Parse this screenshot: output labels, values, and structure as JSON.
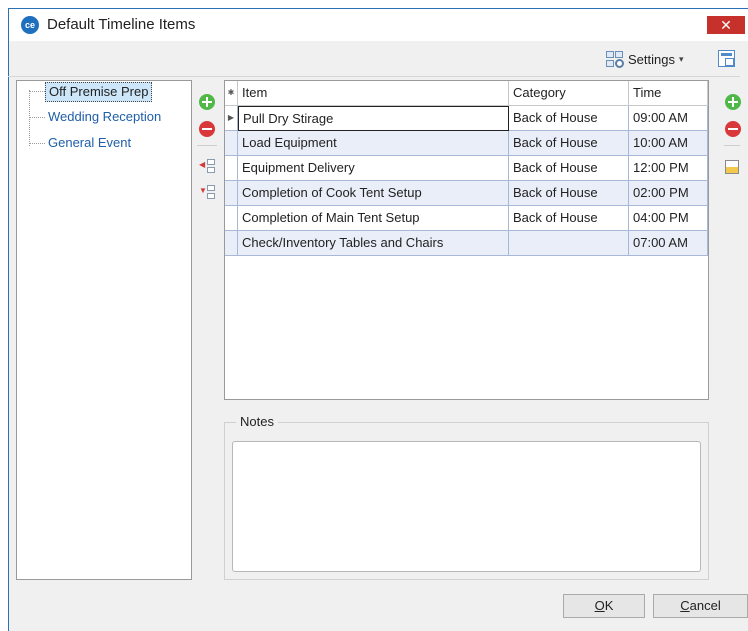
{
  "window": {
    "title": "Default Timeline Items",
    "close_glyph": "✕",
    "app_icon_text": "ce"
  },
  "toolbar": {
    "settings_label": "Settings",
    "settings_caret": "▾"
  },
  "tree": {
    "items": [
      {
        "label": "Off Premise Prep",
        "selected": true
      },
      {
        "label": "Wedding Reception",
        "selected": false
      },
      {
        "label": "General Event",
        "selected": false
      }
    ]
  },
  "grid": {
    "columns": {
      "item": "Item",
      "category": "Category",
      "time": "Time"
    },
    "header_glyph": "✱",
    "current_row_glyph": "▶",
    "rows": [
      {
        "item": "Pull Dry Stirage",
        "category": "Back of House",
        "time": "09:00 AM"
      },
      {
        "item": "Load Equipment",
        "category": "Back of House",
        "time": "10:00 AM"
      },
      {
        "item": "Equipment Delivery",
        "category": "Back of House",
        "time": "12:00 PM"
      },
      {
        "item": "Completion of Cook Tent Setup",
        "category": "Back of House",
        "time": "02:00 PM"
      },
      {
        "item": "Completion of Main Tent Setup",
        "category": "Back of House",
        "time": "04:00 PM"
      },
      {
        "item": "Check/Inventory Tables and Chairs",
        "category": "",
        "time": "07:00 AM"
      }
    ]
  },
  "notes": {
    "label": "Notes",
    "value": ""
  },
  "buttons": {
    "ok_mnemonic": "O",
    "ok_rest": "K",
    "cancel_mnemonic": "C",
    "cancel_rest": "ancel"
  },
  "colors": {
    "accent": "#2b6fb6",
    "close": "#c7312b",
    "add": "#4fb848",
    "remove": "#d9383a",
    "selection": "#cde6fa",
    "row_band": "#e9eef8"
  },
  "icons": {
    "app": "ce-logo-icon",
    "settings": "settings-grid-icon",
    "layout": "layout-panel-icon",
    "add": "add-circle-icon",
    "remove": "remove-circle-icon",
    "indent": "indent-icon",
    "outdent": "outdent-icon",
    "row_edit": "row-edit-icon"
  }
}
